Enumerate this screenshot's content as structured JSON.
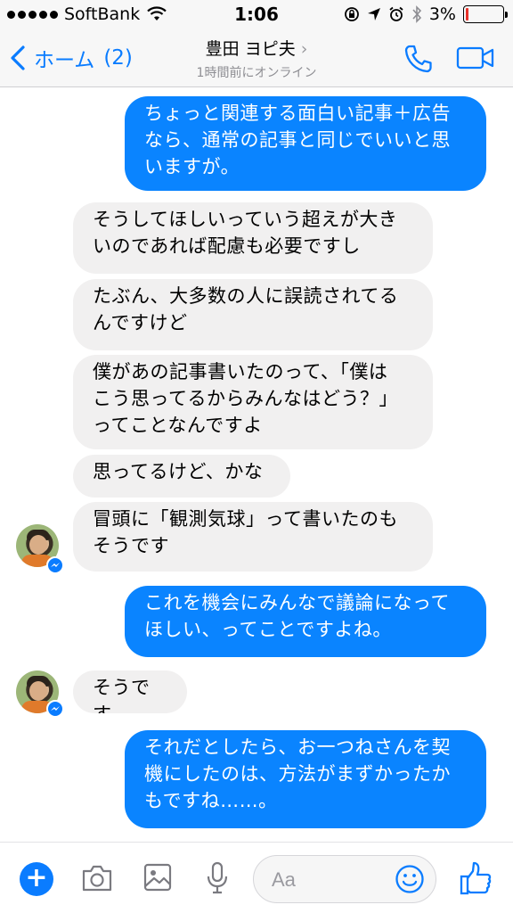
{
  "status_bar": {
    "carrier": "SoftBank",
    "time": "1:06",
    "battery": "3%",
    "battery_level": 0.03,
    "battery_color": "#e8322a"
  },
  "nav": {
    "back_label": "ホーム",
    "unread_count": "(2)",
    "contact_name": "豊田 ヨピ夫",
    "contact_status": "1時間前にオンライン",
    "icons": [
      "chevron-left-icon",
      "chevron-right-icon",
      "phone-icon",
      "video-camera-icon"
    ]
  },
  "messages": [
    {
      "sender": "me",
      "text": "ちょっと関連する面白い記事＋広告\nなら、通常の記事と同じでいいと思\nいますが。"
    },
    {
      "sender": "contact",
      "text": "そうしてほしいっていう超えが大き\nいのであれば配慮も必要ですし"
    },
    {
      "sender": "contact",
      "text": "たぶん、大多数の人に誤読されてる\nんですけど"
    },
    {
      "sender": "contact",
      "text": "僕があの記事書いたのって、「僕は\nこう思ってるからみんなはどう？」\nってことなんですよ"
    },
    {
      "sender": "contact",
      "text": "思ってるけど、かな"
    },
    {
      "sender": "contact",
      "text": "冒頭に「観測気球」って書いたのも\nそうです"
    },
    {
      "sender": "me",
      "text": "これを機会にみんなで議論になって\nほしい、ってことですよね。"
    },
    {
      "sender": "contact",
      "text": "そうです"
    },
    {
      "sender": "me",
      "text": "それだとしたら、お一つねさんを契\n機にしたのは、方法がまずかったか\nもですね……。"
    }
  ],
  "toolbar": {
    "compose_placeholder": "Aa",
    "icons": [
      "plus-icon",
      "camera-icon",
      "photo-icon",
      "microphone-icon",
      "emoji-icon",
      "thumbs-up-icon"
    ]
  },
  "colors": {
    "accent": "#0a7cff",
    "outgoing_bubble": "#0a84ff",
    "incoming_bubble": "#f1f0f0"
  }
}
